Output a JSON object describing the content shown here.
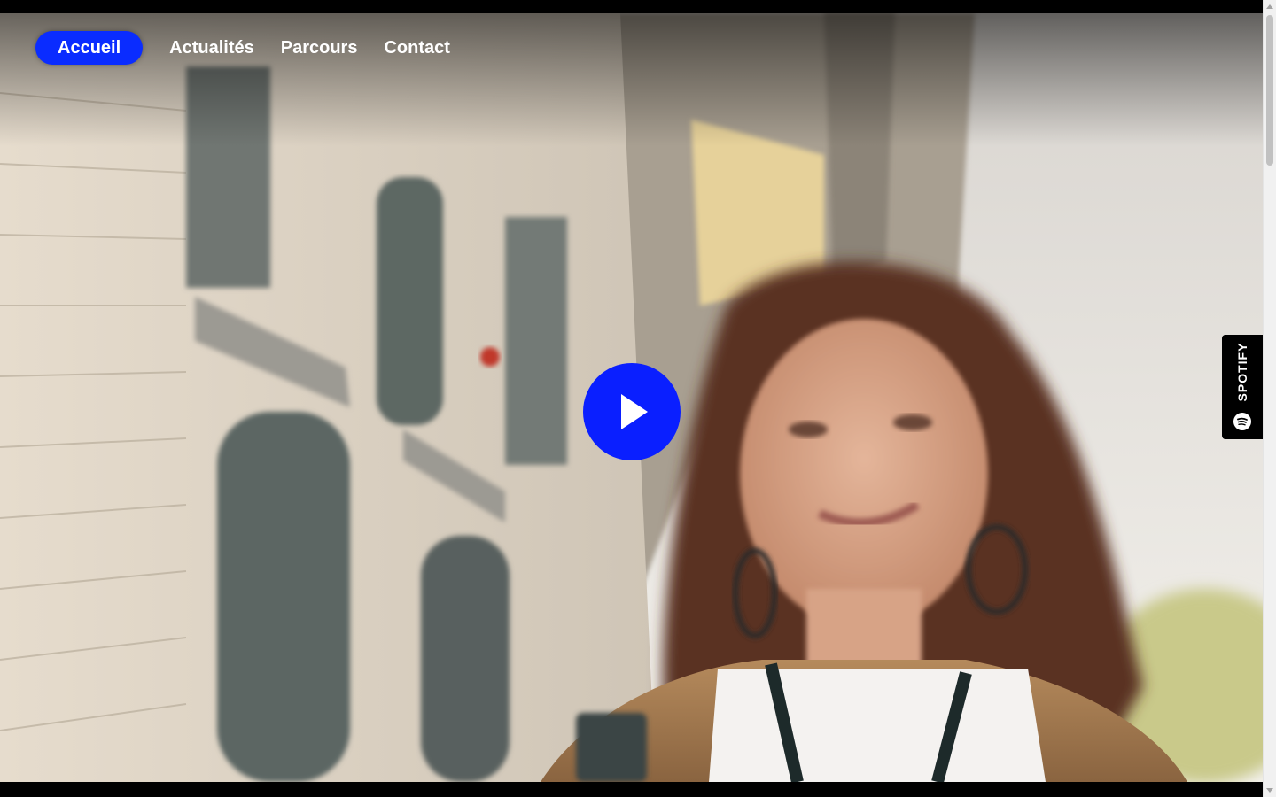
{
  "nav": {
    "items": [
      {
        "label": "Accueil",
        "active": true
      },
      {
        "label": "Actualités",
        "active": false
      },
      {
        "label": "Parcours",
        "active": false
      },
      {
        "label": "Contact",
        "active": false
      }
    ]
  },
  "hero": {
    "play_icon": "play-icon"
  },
  "spotify": {
    "label": "SPOTIFY",
    "icon": "spotify-icon"
  },
  "colors": {
    "accent": "#0a2cff",
    "play": "#0a1fff",
    "tab": "#000000"
  }
}
